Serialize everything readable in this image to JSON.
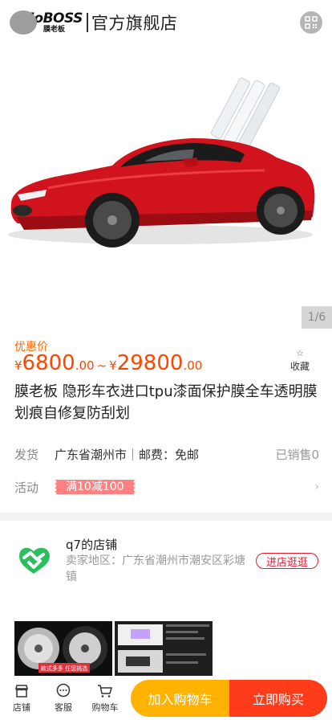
{
  "header": {
    "logo_main": "MoBOSS",
    "logo_sub": "膜老板",
    "store_title": "官方旗舰店",
    "qr_icon": "qr-code-icon"
  },
  "gallery": {
    "pager": "1/6",
    "image": "red sports car with protective film rolls"
  },
  "price": {
    "promo_label": "优惠价",
    "currency": "¥",
    "low_int": "6800",
    "low_dec": ".00",
    "separator": "~",
    "high_int": "29800",
    "high_dec": ".00"
  },
  "favorite": {
    "label": "收藏",
    "icon": "star-icon"
  },
  "product": {
    "title": "膜老板 隐形车衣进口tpu漆面保护膜全车透明膜划痕自修复防刮划"
  },
  "shipping": {
    "label": "发货",
    "location": "广东省潮州市",
    "fee": "邮费：免邮",
    "sold": "已销售0"
  },
  "activity": {
    "label": "活动",
    "coupon": "满10减100",
    "arrow": "›"
  },
  "shop": {
    "name": "q7的店铺",
    "area": "卖家地区：广东省潮州市潮安区彩塘镇",
    "enter_button": "进店逛逛",
    "thumb1_text": "款式多多 任您挑选"
  },
  "bottom_bar": {
    "tabs": [
      {
        "label": "店铺",
        "icon": "store-icon"
      },
      {
        "label": "客服",
        "icon": "chat-icon"
      },
      {
        "label": "购物车",
        "icon": "cart-icon"
      }
    ],
    "add_to_cart": "加入购物车",
    "buy_now": "立即购买"
  },
  "colors": {
    "price": "#ff4500",
    "promo": "#ff6a00",
    "cart_button": "#ffb300",
    "buy_button": "#ff3c1a",
    "enter_border": "#e8192c"
  }
}
